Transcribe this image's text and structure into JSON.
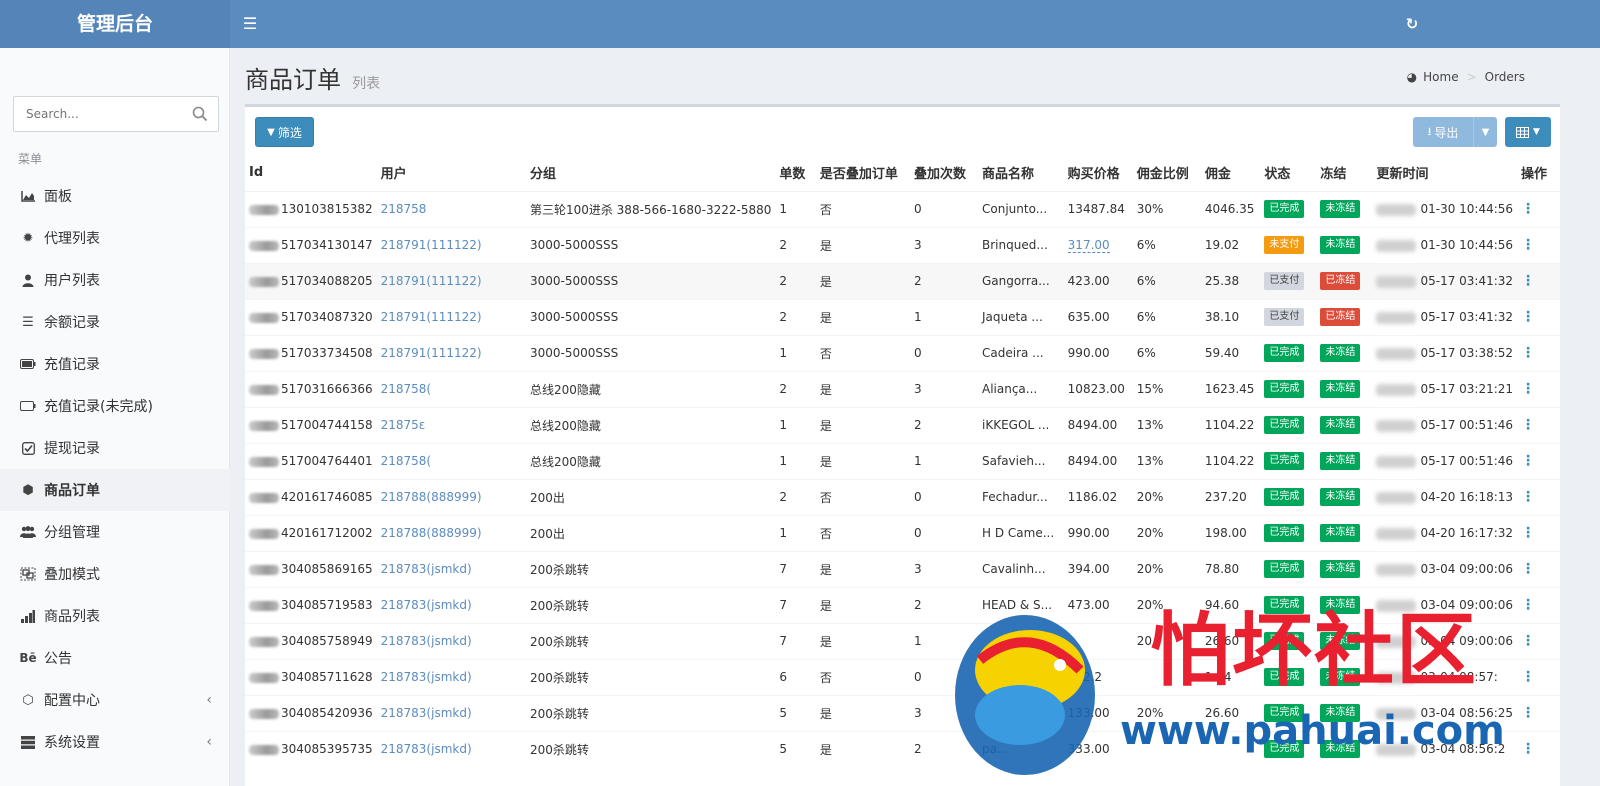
{
  "header": {
    "brand": "管理后台"
  },
  "sidebar": {
    "search_placeholder": "Search...",
    "menu_header": "菜单",
    "items": [
      {
        "label": "面板",
        "icon": "area-chart-icon"
      },
      {
        "label": "代理列表",
        "icon": "gear-icon"
      },
      {
        "label": "用户列表",
        "icon": "user-icon"
      },
      {
        "label": "余额记录",
        "icon": "list-icon"
      },
      {
        "label": "充值记录",
        "icon": "battery-full-icon"
      },
      {
        "label": "充值记录(未完成)",
        "icon": "battery-empty-icon"
      },
      {
        "label": "提现记录",
        "icon": "check-square-icon"
      },
      {
        "label": "商品订单",
        "icon": "cube-icon"
      },
      {
        "label": "分组管理",
        "icon": "users-icon"
      },
      {
        "label": "叠加模式",
        "icon": "object-group-icon"
      },
      {
        "label": "商品列表",
        "icon": "signal-icon"
      },
      {
        "label": "公告",
        "icon": "behance-icon"
      },
      {
        "label": "配置中心",
        "icon": "cogs-icon"
      },
      {
        "label": "系统设置",
        "icon": "server-icon"
      }
    ]
  },
  "content": {
    "title": "商品订单",
    "subtitle": "列表",
    "breadcrumb": {
      "home": "Home",
      "current": "Orders"
    }
  },
  "toolbar": {
    "filter_label": "筛选",
    "export_label": "导出"
  },
  "table": {
    "columns": [
      "Id",
      "用户",
      "分组",
      "单数",
      "是否叠加订单",
      "叠加次数",
      "商品名称",
      "购买价格",
      "佣金比例",
      "佣金",
      "状态",
      "冻结",
      "更新时间",
      "操作"
    ],
    "rows": [
      {
        "id": "130103815382",
        "user": "218758",
        "group": "第三轮100进杀 388-566-1680-3222-5880",
        "count": "1",
        "stacked": "否",
        "stack_times": "0",
        "product": "Conjunto...",
        "price": "13487.84",
        "rate": "30%",
        "commission": "4046.35",
        "status": "已完成",
        "status_color": "green",
        "frozen": "未冻结",
        "frozen_color": "green",
        "updated": "01-30 10:44:56"
      },
      {
        "id": "517034130147",
        "user": "218791(111122)",
        "group": "3000-5000SSS",
        "count": "2",
        "stacked": "是",
        "stack_times": "3",
        "product": "Brinqued...",
        "price": "317.00",
        "rate": "6%",
        "commission": "19.02",
        "status": "未支付",
        "status_color": "orange",
        "frozen": "未冻结",
        "frozen_color": "green",
        "updated": "01-30 10:44:56"
      },
      {
        "id": "517034088205",
        "user": "218791(111122)",
        "group": "3000-5000SSS",
        "count": "2",
        "stacked": "是",
        "stack_times": "2",
        "product": "Gangorra...",
        "price": "423.00",
        "rate": "6%",
        "commission": "25.38",
        "status": "已支付",
        "status_color": "gray",
        "frozen": "已冻结",
        "frozen_color": "red",
        "updated": "05-17 03:41:32"
      },
      {
        "id": "517034087320",
        "user": "218791(111122)",
        "group": "3000-5000SSS",
        "count": "2",
        "stacked": "是",
        "stack_times": "1",
        "product": "Jaqueta ...",
        "price": "635.00",
        "rate": "6%",
        "commission": "38.10",
        "status": "已支付",
        "status_color": "gray",
        "frozen": "已冻结",
        "frozen_color": "red",
        "updated": "05-17 03:41:32"
      },
      {
        "id": "517033734508",
        "user": "218791(111122)",
        "group": "3000-5000SSS",
        "count": "1",
        "stacked": "否",
        "stack_times": "0",
        "product": "Cadeira ...",
        "price": "990.00",
        "rate": "6%",
        "commission": "59.40",
        "status": "已完成",
        "status_color": "green",
        "frozen": "未冻结",
        "frozen_color": "green",
        "updated": "05-17 03:38:52"
      },
      {
        "id": "517031666366",
        "user": "218758(",
        "group": "总线200隐藏",
        "count": "2",
        "stacked": "是",
        "stack_times": "3",
        "product": "Aliança...",
        "price": "10823.00",
        "rate": "15%",
        "commission": "1623.45",
        "status": "已完成",
        "status_color": "green",
        "frozen": "未冻结",
        "frozen_color": "green",
        "updated": "05-17 03:21:21"
      },
      {
        "id": "517004744158",
        "user": "21875ε",
        "group": "总线200隐藏",
        "count": "1",
        "stacked": "是",
        "stack_times": "2",
        "product": "iKKEGOL ...",
        "price": "8494.00",
        "rate": "13%",
        "commission": "1104.22",
        "status": "已完成",
        "status_color": "green",
        "frozen": "未冻结",
        "frozen_color": "green",
        "updated": "05-17 00:51:46"
      },
      {
        "id": "517004764401",
        "user": "218758(",
        "group": "总线200隐藏",
        "count": "1",
        "stacked": "是",
        "stack_times": "1",
        "product": "Safavieh...",
        "price": "8494.00",
        "rate": "13%",
        "commission": "1104.22",
        "status": "已完成",
        "status_color": "green",
        "frozen": "未冻结",
        "frozen_color": "green",
        "updated": "05-17 00:51:46"
      },
      {
        "id": "420161746085",
        "user": "218788(888999)",
        "group": "200出",
        "count": "2",
        "stacked": "否",
        "stack_times": "0",
        "product": "Fechadur...",
        "price": "1186.02",
        "rate": "20%",
        "commission": "237.20",
        "status": "已完成",
        "status_color": "green",
        "frozen": "未冻结",
        "frozen_color": "green",
        "updated": "04-20 16:18:13"
      },
      {
        "id": "420161712002",
        "user": "218788(888999)",
        "group": "200出",
        "count": "1",
        "stacked": "否",
        "stack_times": "0",
        "product": "H D Came...",
        "price": "990.00",
        "rate": "20%",
        "commission": "198.00",
        "status": "已完成",
        "status_color": "green",
        "frozen": "未冻结",
        "frozen_color": "green",
        "updated": "04-20 16:17:32"
      },
      {
        "id": "304085869165",
        "user": "218783(jsmkd)",
        "group": "200杀跳转",
        "count": "7",
        "stacked": "是",
        "stack_times": "3",
        "product": "Cavalinh...",
        "price": "394.00",
        "rate": "20%",
        "commission": "78.80",
        "status": "已完成",
        "status_color": "green",
        "frozen": "未冻结",
        "frozen_color": "green",
        "updated": "03-04 09:00:06"
      },
      {
        "id": "304085719583",
        "user": "218783(jsmkd)",
        "group": "200杀跳转",
        "count": "7",
        "stacked": "是",
        "stack_times": "2",
        "product": "HEAD & S...",
        "price": "473.00",
        "rate": "20%",
        "commission": "94.60",
        "status": "已完成",
        "status_color": "green",
        "frozen": "未冻结",
        "frozen_color": "green",
        "updated": "03-04 09:00:06"
      },
      {
        "id": "304085758949",
        "user": "218783(jsmkd)",
        "group": "200杀跳转",
        "count": "7",
        "stacked": "是",
        "stack_times": "1",
        "product": "",
        "price": "",
        "rate": "20",
        "commission": "26.60",
        "status": "已完成",
        "status_color": "green",
        "frozen": "未冻结",
        "frozen_color": "green",
        "updated": "03-04 09:00:06"
      },
      {
        "id": "304085711628",
        "user": "218783(jsmkd)",
        "group": "200杀跳转",
        "count": "6",
        "stacked": "否",
        "stack_times": "0",
        "product": "",
        "price": "652.2",
        "rate": "",
        "commission": "1 44",
        "status": "已完成",
        "status_color": "green",
        "frozen": "未冻结",
        "frozen_color": "green",
        "updated": "03-04 08:57:"
      },
      {
        "id": "304085420936",
        "user": "218783(jsmkd)",
        "group": "200杀跳转",
        "count": "5",
        "stacked": "是",
        "stack_times": "3",
        "product": "",
        "price": "133.00",
        "rate": "20%",
        "commission": "26.60",
        "status": "已完成",
        "status_color": "green",
        "frozen": "未冻结",
        "frozen_color": "green",
        "updated": "03-04 08:56:25"
      },
      {
        "id": "304085395735",
        "user": "218783(jsmkd)",
        "group": "200杀跳转",
        "count": "5",
        "stacked": "是",
        "stack_times": "2",
        "product": "pa...",
        "price": "333.00",
        "rate": "",
        "commission": "",
        "status": "已完成",
        "status_color": "green",
        "frozen": "未冻结",
        "frozen_color": "green",
        "updated": "03-04 08:56:2"
      }
    ]
  },
  "watermark": {
    "text": "怕坏社区",
    "url": "www.pahuai.com"
  },
  "colors": {
    "topbar": "#5b8cbf",
    "primary": "#3c8dbc",
    "green": "#00a65a",
    "orange": "#f39c12",
    "red": "#dd4b39"
  }
}
